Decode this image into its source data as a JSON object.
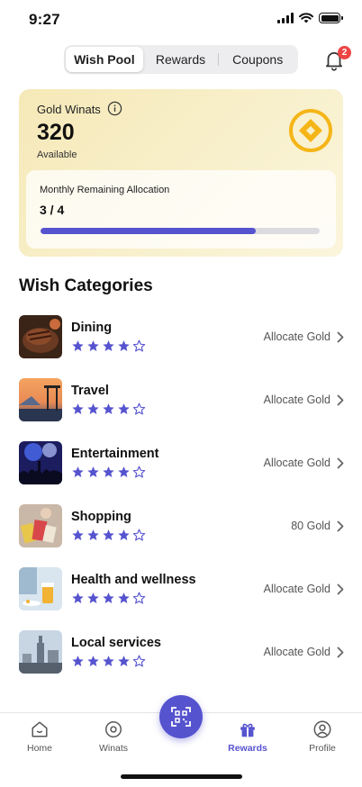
{
  "status_bar": {
    "time": "9:27"
  },
  "tabs": {
    "items": [
      {
        "label": "Wish Pool",
        "active": true
      },
      {
        "label": "Rewards",
        "active": false
      },
      {
        "label": "Coupons",
        "active": false
      }
    ]
  },
  "notifications": {
    "icon": "bell-icon",
    "badge_count": "2"
  },
  "gold_card": {
    "label": "Gold Winats",
    "info_icon": "info-icon",
    "value": "320",
    "sub_label": "Available",
    "coin_icon": "gold-coin-icon",
    "allocation_label": "Monthly Remaining Allocation",
    "allocation_value": "3 / 4",
    "allocation_progress": 0.77
  },
  "section_title": "Wish Categories",
  "categories": [
    {
      "name": "Dining",
      "rating": 4,
      "max_rating": 5,
      "action": "Allocate Gold",
      "thumb": "dining-image"
    },
    {
      "name": "Travel",
      "rating": 4,
      "max_rating": 5,
      "action": "Allocate Gold",
      "thumb": "travel-image"
    },
    {
      "name": "Entertainment",
      "rating": 4,
      "max_rating": 5,
      "action": "Allocate Gold",
      "thumb": "entertainment-image"
    },
    {
      "name": "Shopping",
      "rating": 4,
      "max_rating": 5,
      "action": "80 Gold",
      "thumb": "shopping-image"
    },
    {
      "name": "Health and wellness",
      "rating": 4,
      "max_rating": 5,
      "action": "Allocate Gold",
      "thumb": "health-image"
    },
    {
      "name": "Local services",
      "rating": 4,
      "max_rating": 5,
      "action": "Allocate Gold",
      "thumb": "local-services-image"
    }
  ],
  "tabbar": {
    "items": [
      {
        "label": "Home",
        "icon": "home-icon",
        "active": false
      },
      {
        "label": "Winats",
        "icon": "coin-icon",
        "active": false
      },
      {
        "label": "Rewards",
        "icon": "gift-icon",
        "active": true
      },
      {
        "label": "Profile",
        "icon": "profile-icon",
        "active": false
      }
    ],
    "center_button_icon": "qr-scan-icon"
  },
  "colors": {
    "accent": "#5653cf",
    "gold": "#f5b517",
    "badge": "#ef4444",
    "card_bg": "#f8f0cc"
  }
}
